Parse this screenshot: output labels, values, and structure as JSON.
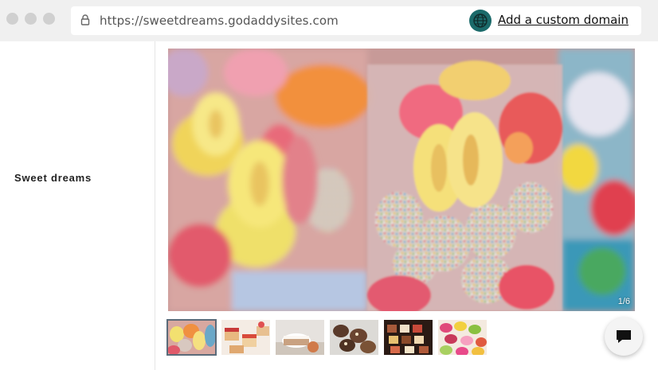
{
  "browser": {
    "url": "https://sweetdreams.godaddysites.com",
    "domain_cta": "Add a custom domain",
    "icons": {
      "lock": "lock-icon",
      "globe": "globe-icon"
    },
    "globe_color": "#1b6a6a"
  },
  "site": {
    "title": "Sweet dreams"
  },
  "gallery": {
    "counter": "1/6",
    "current_index": 1,
    "total": 6,
    "thumbnails": [
      {
        "label": "gummy candy",
        "active": true
      },
      {
        "label": "cakes",
        "active": false
      },
      {
        "label": "dessert with cream",
        "active": false
      },
      {
        "label": "chocolate bites",
        "active": false
      },
      {
        "label": "petit fours",
        "active": false
      },
      {
        "label": "macarons",
        "active": false
      }
    ]
  },
  "chat": {
    "icon": "chat-icon"
  }
}
